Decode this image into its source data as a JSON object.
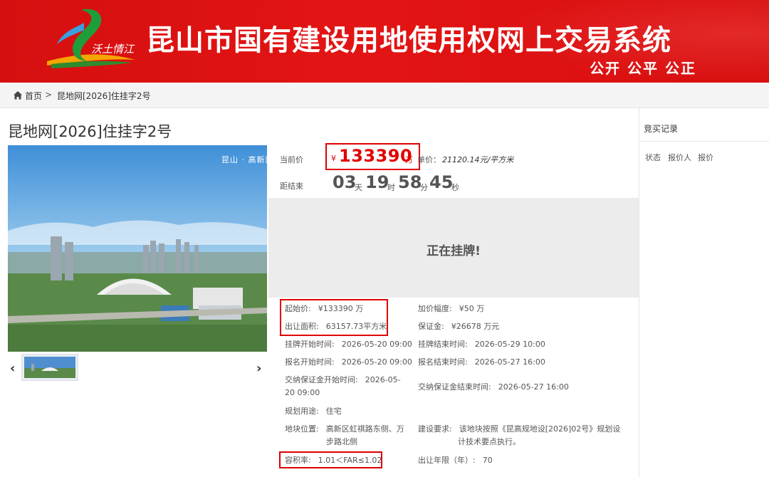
{
  "header": {
    "logo_text": "沃土情江",
    "title": "昆山市国有建设用地使用权网上交易系统",
    "slogan": "公开 公平 公正"
  },
  "breadcrumb": {
    "home": "首页",
    "separator": ">",
    "current": "昆地网[2026]住挂字2号"
  },
  "listing": {
    "title": "昆地网[2026]住挂字2号",
    "photo_watermark": "昆山 · 高新区",
    "current_price_label": "当前价",
    "currency": "¥",
    "current_price": "133390",
    "price_unit": "万",
    "unit_price_label": "单价：",
    "unit_price": "21120.14元/平方米",
    "remaining_label": "距结束",
    "countdown": {
      "days": "03",
      "days_unit": "天",
      "hours": "19",
      "hours_unit": "时",
      "minutes": "58",
      "minutes_unit": "分",
      "seconds": "45",
      "seconds_unit": "秒"
    },
    "status": "正在挂牌!"
  },
  "details": {
    "start_price_label": "起始价:",
    "start_price": "¥133390 万",
    "increment_label": "加价幅度:",
    "increment": "¥50 万",
    "area_label": "出让面积:",
    "area": "63157.73平方米",
    "deposit_label": "保证金:",
    "deposit": "¥26678 万元",
    "listing_start_label": "挂牌开始时间:",
    "listing_start": "2026-05-20 09:00",
    "listing_end_label": "挂牌结束时间:",
    "listing_end": "2026-05-29 10:00",
    "signup_start_label": "报名开始时间:",
    "signup_start": "2026-05-20 09:00",
    "signup_end_label": "报名结束时间:",
    "signup_end": "2026-05-27 16:00",
    "deposit_start_label": "交纳保证金开始时间:",
    "deposit_start_line1": "2026-05-",
    "deposit_start_line2": "20 09:00",
    "deposit_end_label": "交纳保证金结束时间:",
    "deposit_end": "2026-05-27 16:00",
    "usage_label": "规划用途:",
    "usage": "住宅",
    "location_label": "地块位置:",
    "location_line1": "高新区虹祺路东侧、万",
    "location_line2": "步路北侧",
    "requirements_label": "建设要求:",
    "requirements_line1": "该地块按照《昆高规地设[2026]02号》规划设",
    "requirements_line2": "计技术要点执行。",
    "far_label": "容积率:",
    "far": "1.01＜FAR≤1.02",
    "term_label": "出让年限（年）:",
    "term": "70"
  },
  "sidebar": {
    "title": "竞买记录",
    "columns": [
      "状态",
      "报价人",
      "报价"
    ]
  },
  "colors": {
    "banner_red": "#e31414",
    "highlight_red": "#e00000",
    "status_panel": "#ececec"
  },
  "icons": [
    "home-icon",
    "chevron-left-icon",
    "chevron-right-icon"
  ]
}
